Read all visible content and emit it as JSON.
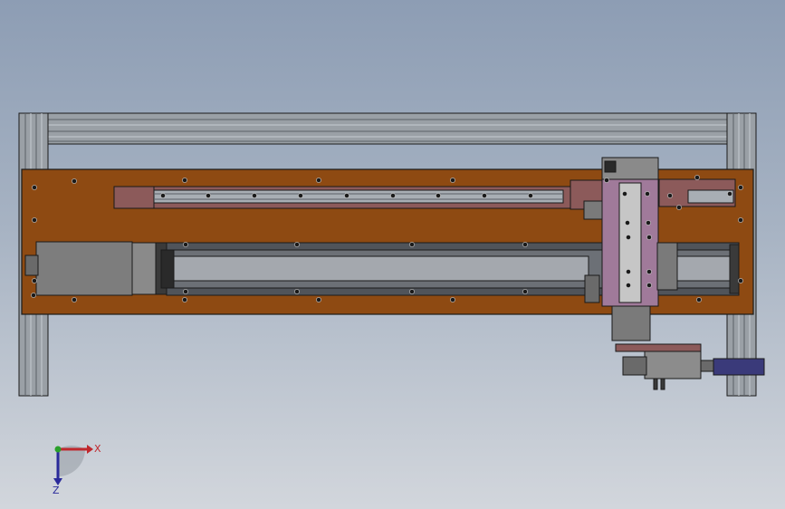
{
  "viewport": {
    "background_top": "#8d9db4",
    "background_bottom": "#d2d6dc"
  },
  "colors": {
    "base_plate": "#8e4a12",
    "rail_mount": "#8c5a5a",
    "aluminum": "#9aa0a6",
    "motor": "#7d7d7d",
    "carriage_plate": "#a07a9a",
    "cylinder": "#3a3a7a",
    "outline": "#1a1a1a"
  },
  "triad": {
    "x_label": "X",
    "z_label": "Z",
    "x_color": "#c0282d",
    "z_color": "#2a2a9a",
    "y_color": "#2aa02a"
  }
}
